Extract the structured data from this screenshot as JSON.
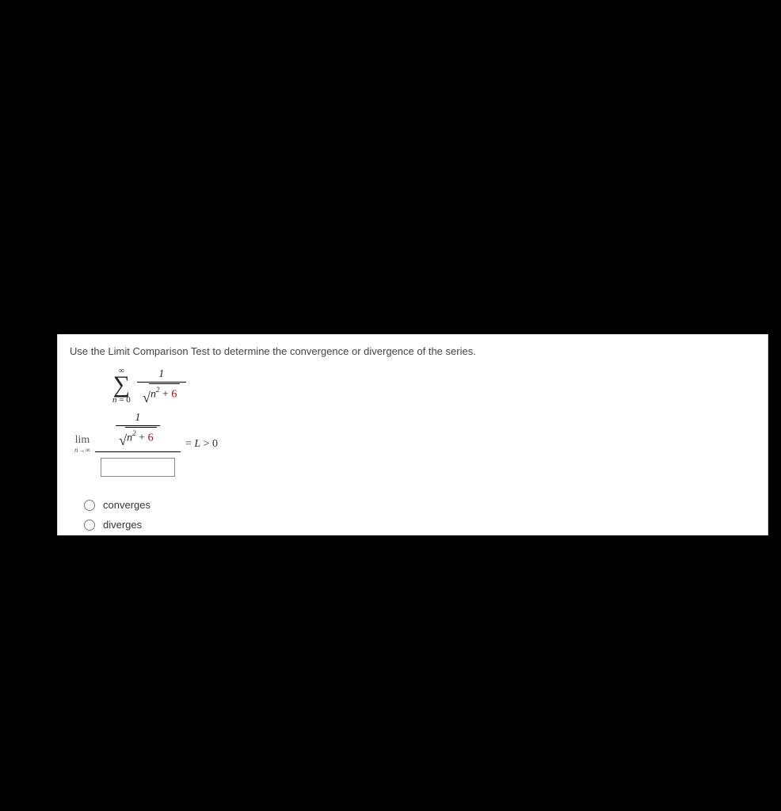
{
  "prompt": "Use the Limit Comparison Test to determine the convergence or divergence of the series.",
  "series": {
    "sigma_top": "∞",
    "sigma_bottom_var": "n",
    "sigma_bottom_eq": " = 0",
    "numerator": "1",
    "rad_var": "n",
    "rad_exp": "2",
    "rad_plus": " + ",
    "rad_const": "6"
  },
  "limit": {
    "lim": "lim",
    "sub_var": "n",
    "sub_arrow": "→∞",
    "num_numerator": "1",
    "num_rad_var": "n",
    "num_rad_exp": "2",
    "num_rad_plus": " + ",
    "num_rad_const": "6",
    "rhs_eq": " = ",
    "rhs_L": "L",
    "rhs_gt": " > 0"
  },
  "input": {
    "value": ""
  },
  "options": {
    "opt1": "converges",
    "opt2": "diverges"
  }
}
